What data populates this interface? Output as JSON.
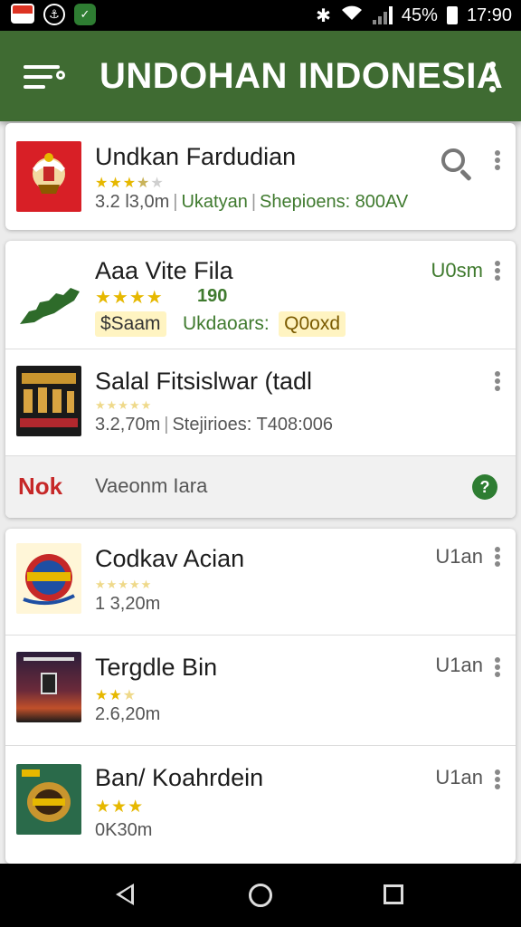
{
  "status_bar": {
    "battery": "45%",
    "time": "17:90",
    "icons": [
      "flag-icon",
      "anchor-icon",
      "shield-icon",
      "bluetooth-icon",
      "wifi-icon",
      "signal-icon",
      "battery-icon"
    ]
  },
  "app_bar": {
    "title": "UNDOHAN INDONESIA",
    "color": "#3f6b32"
  },
  "card1": {
    "title": "Undkan Fardudian",
    "rating": 3.5,
    "size": "3.2 l3,0m",
    "field1": "Ukatyan",
    "field2": "Shepioens: 800AV"
  },
  "card2": {
    "item1": {
      "title": "Aaa Vite Fila",
      "rating_value": "190",
      "right_label": "U0sm",
      "tag1": "$Saam",
      "info": "Ukdaoars:",
      "tag2": "Q0oxd"
    },
    "item2": {
      "title": "Salal Fitsislwar (tadl",
      "size": "3.2,70m",
      "shipping": "Stejirioes: T408:006"
    },
    "footer": {
      "badge": "Nok",
      "text": "Vaeonm Iara",
      "help": "?"
    }
  },
  "card3": {
    "items": [
      {
        "title": "Codkav Acian",
        "size": "1 3,20m",
        "right_label": "U1an"
      },
      {
        "title": "Tergdle Bin",
        "size": "2.6,20m",
        "right_label": "U1an"
      },
      {
        "title": "Ban/ Koahrdein",
        "size": "0K30m",
        "right_label": "U1an"
      }
    ]
  },
  "colors": {
    "accent_green": "#3f6b32",
    "star_yellow": "#e6b800",
    "badge_red": "#c62828"
  }
}
